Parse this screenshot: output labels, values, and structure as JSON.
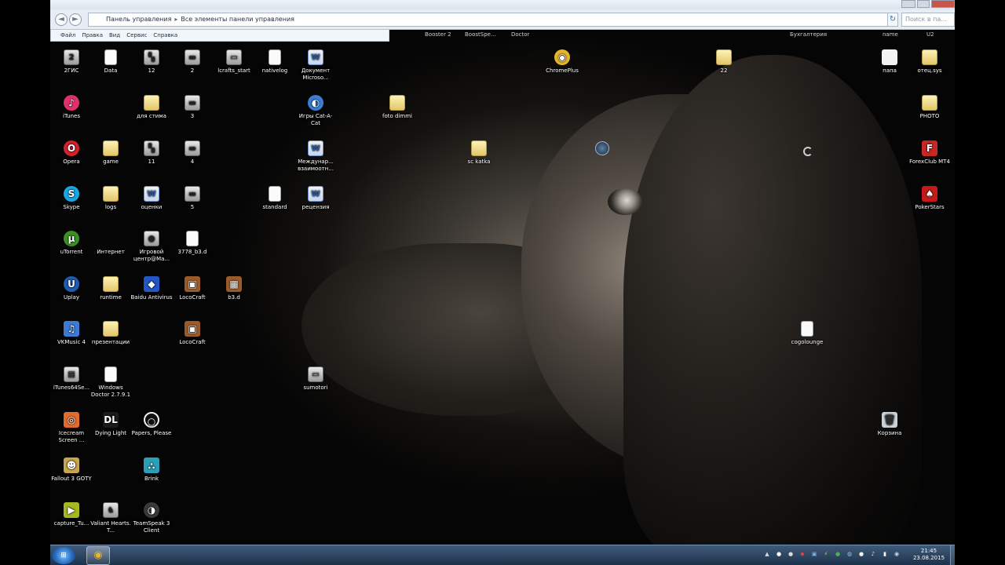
{
  "window": {
    "nav_back": "◄",
    "nav_forward": "►",
    "path": [
      "Панель управления",
      "Все элементы панели управления"
    ],
    "path_separator": "▸",
    "refresh_icon": "↻",
    "search_placeholder": "Поиск в па..."
  },
  "menu": [
    "Файл",
    "Правка",
    "Вид",
    "Сервис",
    "Справка"
  ],
  "peek_labels": [
    "Booster 2",
    "BoostSpe...",
    "Doctor",
    "Бухгалтерия",
    "name",
    "U2"
  ],
  "desktop_icons": [
    {
      "label": "2ГИС",
      "glyph": "2",
      "kind": "exe"
    },
    {
      "label": "Data",
      "glyph": "",
      "kind": "doc"
    },
    {
      "label": "12",
      "glyph": "▚",
      "kind": "exe"
    },
    {
      "label": "2",
      "glyph": "▬",
      "kind": "exe"
    },
    {
      "label": "lcrafts_start",
      "glyph": "▭",
      "kind": "exe"
    },
    {
      "label": "nativelog",
      "glyph": "",
      "kind": "doc"
    },
    {
      "label": "Документ Microso...",
      "glyph": "W",
      "kind": "word"
    },
    {
      "label": "ChromePlus",
      "glyph": "◉",
      "kind": "chrome"
    },
    {
      "label": "22",
      "glyph": "",
      "kind": "folder"
    },
    {
      "label": "папа",
      "glyph": "",
      "kind": "white"
    },
    {
      "label": "отец.sys",
      "glyph": "",
      "kind": "folder"
    },
    {
      "label": "iTunes",
      "glyph": "♪",
      "kind": "itunes"
    },
    {
      "label": "для стима",
      "glyph": "",
      "kind": "folder"
    },
    {
      "label": "3",
      "glyph": "▬",
      "kind": "exe"
    },
    {
      "label": "Игры Cat-A-Cat",
      "glyph": "◐",
      "kind": "globe"
    },
    {
      "label": "foto dimmi",
      "glyph": "",
      "kind": "folder"
    },
    {
      "label": "PHOTO",
      "glyph": "",
      "kind": "folder"
    },
    {
      "label": "Opera",
      "glyph": "O",
      "kind": "opera"
    },
    {
      "label": "game",
      "glyph": "",
      "kind": "folder"
    },
    {
      "label": "11",
      "glyph": "▚",
      "kind": "exe"
    },
    {
      "label": "4",
      "glyph": "▬",
      "kind": "exe"
    },
    {
      "label": "Междунар... взаимоотн...",
      "glyph": "W",
      "kind": "word"
    },
    {
      "label": "sc katka",
      "glyph": "",
      "kind": "folder"
    },
    {
      "label": "ForexClub MT4",
      "glyph": "F",
      "kind": "forex"
    },
    {
      "label": "Skype",
      "glyph": "S",
      "kind": "skype"
    },
    {
      "label": "logs",
      "glyph": "",
      "kind": "folder"
    },
    {
      "label": "оценки",
      "glyph": "W",
      "kind": "word"
    },
    {
      "label": "5",
      "glyph": "▬",
      "kind": "exe"
    },
    {
      "label": "standard",
      "glyph": "",
      "kind": "doc"
    },
    {
      "label": "рецензия",
      "glyph": "W",
      "kind": "word"
    },
    {
      "label": "PokerStars",
      "glyph": "♠",
      "kind": "poker"
    },
    {
      "label": "uTorrent",
      "glyph": "µ",
      "kind": "utorrent"
    },
    {
      "label": "Интернет",
      "glyph": "",
      "kind": "none"
    },
    {
      "label": "Игровой центр@Ма...",
      "glyph": "●",
      "kind": "exe"
    },
    {
      "label": "3778_b3.d",
      "glyph": "",
      "kind": "doc"
    },
    {
      "label": "Uplay",
      "glyph": "U",
      "kind": "uplay"
    },
    {
      "label": "runtime",
      "glyph": "",
      "kind": "folder"
    },
    {
      "label": "Baidu Antivirus",
      "glyph": "◆",
      "kind": "baidu"
    },
    {
      "label": "LocoCraft",
      "glyph": "▣",
      "kind": "loco"
    },
    {
      "label": "b3.d",
      "glyph": "▦",
      "kind": "loco"
    },
    {
      "label": "VKMusic 4",
      "glyph": "♫",
      "kind": "vkmusic"
    },
    {
      "label": "презентации",
      "glyph": "",
      "kind": "folder"
    },
    {
      "label": "LocoCraft",
      "glyph": "▣",
      "kind": "loco"
    },
    {
      "label": "cogolounge",
      "glyph": "",
      "kind": "doc"
    },
    {
      "label": "iTunes64Se...",
      "glyph": "▤",
      "kind": "exe"
    },
    {
      "label": "Windows Doctor 2.7.9.1",
      "glyph": "",
      "kind": "doc"
    },
    {
      "label": "sumotori",
      "glyph": "▭",
      "kind": "exe"
    },
    {
      "label": "Icecream Screen ...",
      "glyph": "◎",
      "kind": "icecream"
    },
    {
      "label": "Dying Light",
      "glyph": "DL",
      "kind": "dying"
    },
    {
      "label": "Papers, Please",
      "glyph": "○",
      "kind": "papers"
    },
    {
      "label": "Корзина",
      "glyph": "🗑",
      "kind": "bin"
    },
    {
      "label": "Fallout 3 GOTY",
      "glyph": "☻",
      "kind": "fallout"
    },
    {
      "label": "Brink",
      "glyph": "⛬",
      "kind": "brink"
    },
    {
      "label": "capture_Tu...",
      "glyph": "▶",
      "kind": "capture"
    },
    {
      "label": "Valiant Hearts. T...",
      "glyph": "♞",
      "kind": "exe"
    },
    {
      "label": "TeamSpeak 3 Client",
      "glyph": "◑",
      "kind": "ts"
    }
  ],
  "overlay_icons": {
    "steam": "steam-icon",
    "busy_cursor": "busy-cursor-icon"
  },
  "taskbar": {
    "start_glyph": "⊞",
    "chrome_glyph": "◉",
    "tray_glyphs": [
      "▲",
      "●",
      "●",
      "◆",
      "▣",
      "⚡",
      "●",
      "◍",
      "●",
      "♪",
      "▮",
      "◉"
    ],
    "time": "21:45",
    "date": "23.08.2015"
  },
  "colors": {
    "itunes": "#e0316a",
    "opera": "#d6202b",
    "skype": "#18a7e6",
    "utorrent": "#3b8f25",
    "uplay": "#1e5db3",
    "vkmusic": "#3d7ad6",
    "chrome": "#e7b52a",
    "poker": "#c41a1a",
    "forex": "#c92626",
    "baidu": "#2456c6",
    "loco": "#9b5a2a",
    "icecream": "#e46a2e",
    "fallout": "#c9a54d",
    "brink": "#2aa0b8",
    "capture": "#a6b81f",
    "papers": "#111111",
    "dying": "#1b1b1b",
    "ts": "#3a3a3a",
    "globe": "#3b7fd4",
    "white": "#f2f2f2",
    "bin": "#c7d2dc"
  }
}
